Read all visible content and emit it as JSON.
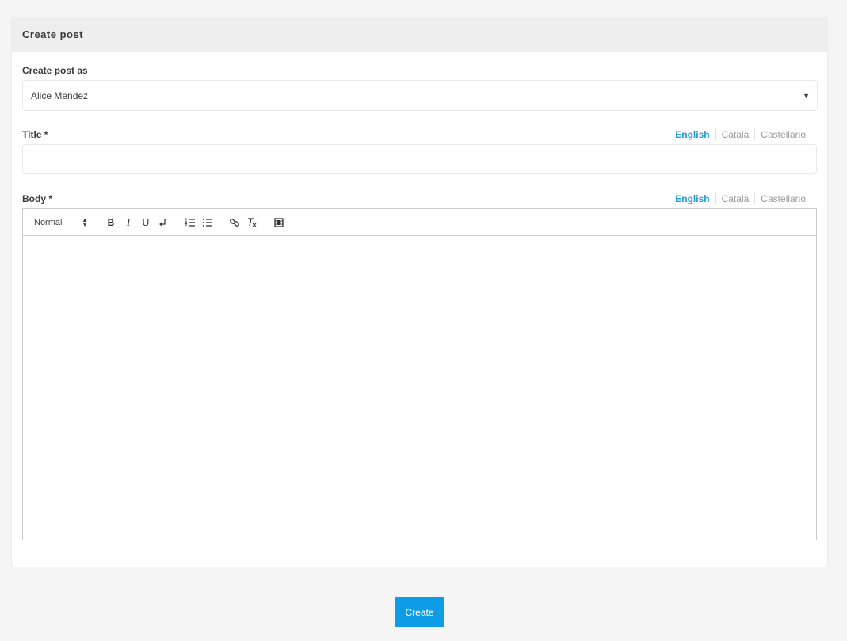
{
  "card": {
    "title": "Create post"
  },
  "author": {
    "label": "Create post as",
    "selected": "Alice Mendez"
  },
  "title_field": {
    "label": "Title *",
    "value": "",
    "languages": [
      "English",
      "Català",
      "Castellano"
    ],
    "active_language": "English"
  },
  "body_field": {
    "label": "Body *",
    "languages": [
      "English",
      "Català",
      "Castellano"
    ],
    "active_language": "English",
    "toolbar": {
      "format_select": "Normal",
      "buttons": [
        "bold-icon",
        "italic-icon",
        "underline-icon",
        "link-break-icon",
        "ordered-list-icon",
        "bullet-list-icon",
        "link-icon",
        "clear-format-icon",
        "video-icon"
      ]
    },
    "content": ""
  },
  "actions": {
    "create_label": "Create"
  },
  "colors": {
    "accent": "#1a9bd8",
    "button": "#0e9ce6",
    "header_bg": "#eeeeee",
    "page_bg": "#f5f5f5"
  }
}
